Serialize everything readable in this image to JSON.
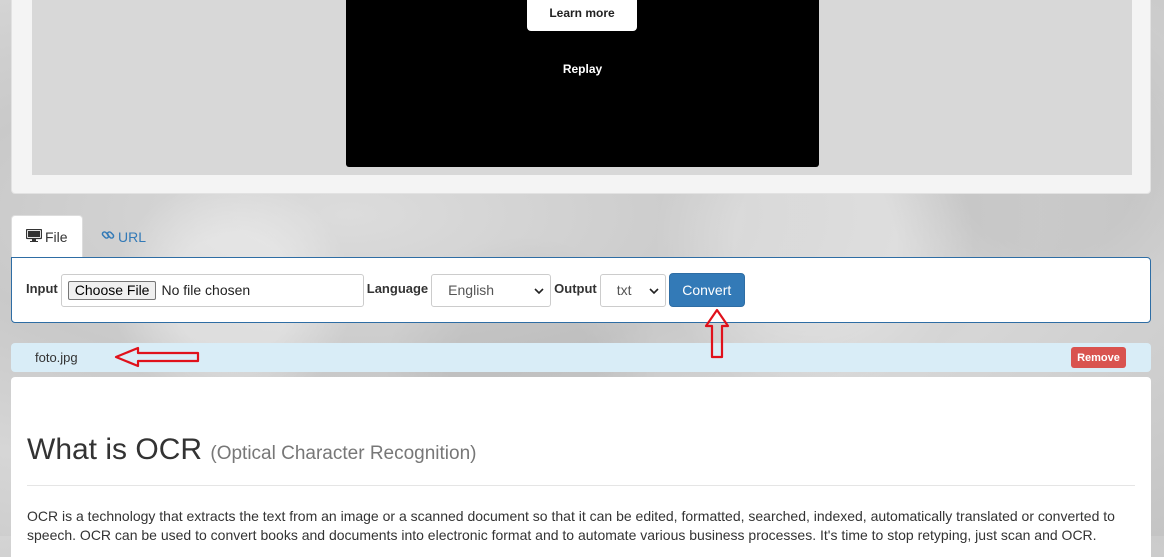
{
  "ad": {
    "learn_more_label": "Learn more",
    "replay_label": "Replay"
  },
  "tabs": [
    {
      "label": "File",
      "icon": "monitor-icon",
      "active": true
    },
    {
      "label": "URL",
      "icon": "link-icon",
      "active": false
    }
  ],
  "form": {
    "input_label": "Input",
    "choose_file_label": "Choose File",
    "file_status": "No file chosen",
    "language_label": "Language",
    "language_value": "English",
    "output_label": "Output",
    "output_value": "txt",
    "convert_label": "Convert"
  },
  "file_row": {
    "file_name": "foto.jpg",
    "remove_label": "Remove"
  },
  "content": {
    "title": "What is OCR",
    "subtitle": "(Optical Character Recognition)",
    "paragraph": "OCR is a technology that extracts the text from an image or a scanned document so that it can be edited, formatted, searched, indexed, automatically translated or converted to speech. OCR can be used to convert books and documents into electronic format and to automate various business processes. It's time to stop retyping, just scan and OCR."
  },
  "colors": {
    "primary": "#337ab7",
    "danger": "#d9534f",
    "info_bg": "#d9edf7",
    "annotation": "#e0111b"
  }
}
